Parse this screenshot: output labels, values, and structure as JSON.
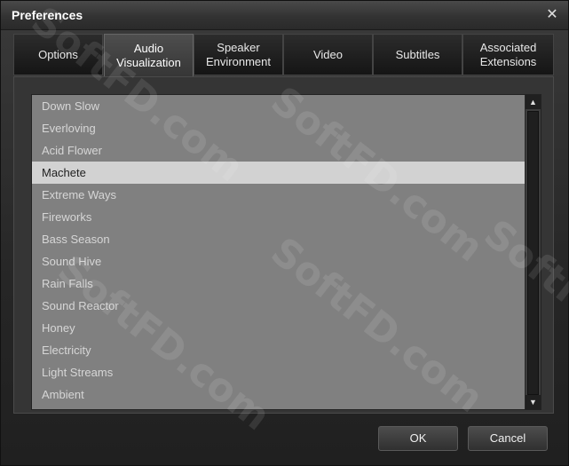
{
  "window": {
    "title": "Preferences"
  },
  "tabs": [
    {
      "label": "Options",
      "active": false
    },
    {
      "label": "Audio\nVisualization",
      "active": true
    },
    {
      "label": "Speaker\nEnvironment",
      "active": false
    },
    {
      "label": "Video",
      "active": false
    },
    {
      "label": "Subtitles",
      "active": false
    },
    {
      "label": "Associated\nExtensions",
      "active": false
    }
  ],
  "visualizations": {
    "items": [
      "Down Slow",
      "Everloving",
      "Acid Flower",
      "Machete",
      "Extreme Ways",
      "Fireworks",
      "Bass Season",
      "Sound Hive",
      "Rain Falls",
      "Sound Reactor",
      "Honey",
      "Electricity",
      "Light Streams",
      "Ambient"
    ],
    "selected": "Machete"
  },
  "buttons": {
    "ok": "OK",
    "cancel": "Cancel"
  },
  "watermark": "SoftFD.com",
  "colors": {
    "list_background": "#808080",
    "selected_row": "#d2d2d2",
    "title_text": "#ffffff"
  }
}
